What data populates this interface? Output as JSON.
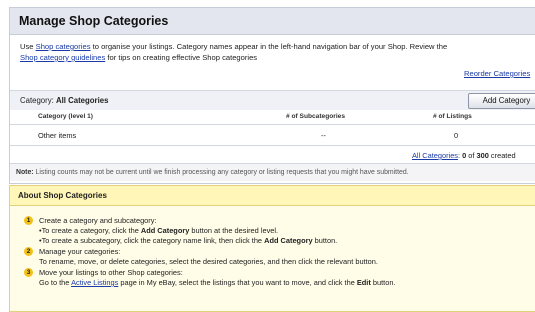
{
  "header": {
    "title": "Manage Shop Categories"
  },
  "intro": {
    "t1": "Use ",
    "link1": "Shop categories",
    "t2": " to organise your listings. Category names appear in the left-hand navigation bar of your Shop. Review the",
    "link2": "Shop category guidelines",
    "t3": " for tips on creating effective Shop categories"
  },
  "reorder_link": "Reorder Categories",
  "category_bar": {
    "label": "Category:",
    "value": "All Categories",
    "add_button": "Add Category"
  },
  "table": {
    "columns": [
      "Category (level 1)",
      "# of Subcategories",
      "# of Listings"
    ],
    "rows": [
      {
        "name": "Other items",
        "subcategories": "--",
        "listings": "0"
      }
    ]
  },
  "summary": {
    "link": "All Categories",
    "text1": ": ",
    "count": "0",
    "text2": " of ",
    "max": "300",
    "text3": " created"
  },
  "note": {
    "label": "Note:",
    "text": " Listing counts may not be current until we finish processing any category or listing requests that you might have submitted."
  },
  "about": {
    "title": "About Shop Categories",
    "steps": [
      {
        "num": "1",
        "title": "Create a category and subcategory:",
        "l1a": "•To create a category, click the ",
        "l1b": "Add Category",
        "l1c": " button at the desired level.",
        "l2a": "•To create a subcategory, click the category name link, then click the ",
        "l2b": "Add Category",
        "l2c": " button."
      },
      {
        "num": "2",
        "title": "Manage your categories:",
        "l1": "To rename, move, or delete categories, select the desired categories, and then click the relevant button."
      },
      {
        "num": "3",
        "title": "Move your listings to other Shop categories:",
        "l1a": "Go to the ",
        "l1link": "Active Listings",
        "l1b": " page in My eBay, select the listings that you want to move, and click the ",
        "l1bold": "Edit",
        "l1c": " button."
      }
    ]
  }
}
